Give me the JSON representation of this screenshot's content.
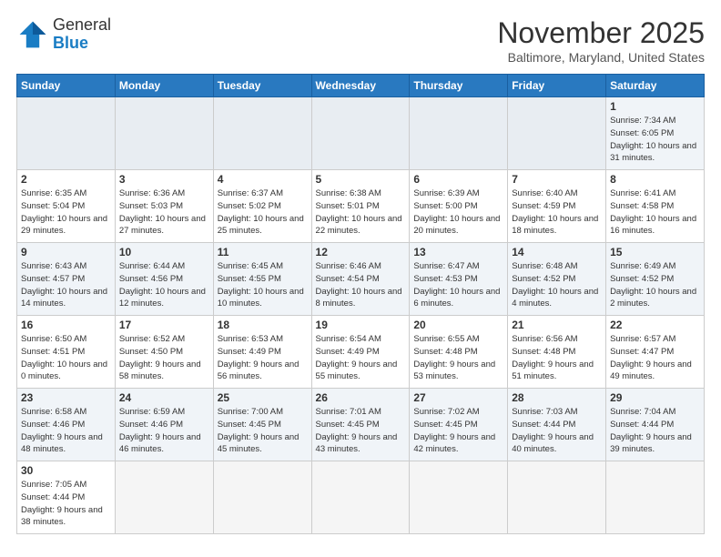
{
  "header": {
    "logo_general": "General",
    "logo_blue": "Blue",
    "month_title": "November 2025",
    "location": "Baltimore, Maryland, United States"
  },
  "days_of_week": [
    "Sunday",
    "Monday",
    "Tuesday",
    "Wednesday",
    "Thursday",
    "Friday",
    "Saturday"
  ],
  "weeks": [
    [
      {
        "day": "",
        "info": ""
      },
      {
        "day": "",
        "info": ""
      },
      {
        "day": "",
        "info": ""
      },
      {
        "day": "",
        "info": ""
      },
      {
        "day": "",
        "info": ""
      },
      {
        "day": "",
        "info": ""
      },
      {
        "day": "1",
        "info": "Sunrise: 7:34 AM\nSunset: 6:05 PM\nDaylight: 10 hours and 31 minutes."
      }
    ],
    [
      {
        "day": "2",
        "info": "Sunrise: 6:35 AM\nSunset: 5:04 PM\nDaylight: 10 hours and 29 minutes."
      },
      {
        "day": "3",
        "info": "Sunrise: 6:36 AM\nSunset: 5:03 PM\nDaylight: 10 hours and 27 minutes."
      },
      {
        "day": "4",
        "info": "Sunrise: 6:37 AM\nSunset: 5:02 PM\nDaylight: 10 hours and 25 minutes."
      },
      {
        "day": "5",
        "info": "Sunrise: 6:38 AM\nSunset: 5:01 PM\nDaylight: 10 hours and 22 minutes."
      },
      {
        "day": "6",
        "info": "Sunrise: 6:39 AM\nSunset: 5:00 PM\nDaylight: 10 hours and 20 minutes."
      },
      {
        "day": "7",
        "info": "Sunrise: 6:40 AM\nSunset: 4:59 PM\nDaylight: 10 hours and 18 minutes."
      },
      {
        "day": "8",
        "info": "Sunrise: 6:41 AM\nSunset: 4:58 PM\nDaylight: 10 hours and 16 minutes."
      }
    ],
    [
      {
        "day": "9",
        "info": "Sunrise: 6:43 AM\nSunset: 4:57 PM\nDaylight: 10 hours and 14 minutes."
      },
      {
        "day": "10",
        "info": "Sunrise: 6:44 AM\nSunset: 4:56 PM\nDaylight: 10 hours and 12 minutes."
      },
      {
        "day": "11",
        "info": "Sunrise: 6:45 AM\nSunset: 4:55 PM\nDaylight: 10 hours and 10 minutes."
      },
      {
        "day": "12",
        "info": "Sunrise: 6:46 AM\nSunset: 4:54 PM\nDaylight: 10 hours and 8 minutes."
      },
      {
        "day": "13",
        "info": "Sunrise: 6:47 AM\nSunset: 4:53 PM\nDaylight: 10 hours and 6 minutes."
      },
      {
        "day": "14",
        "info": "Sunrise: 6:48 AM\nSunset: 4:52 PM\nDaylight: 10 hours and 4 minutes."
      },
      {
        "day": "15",
        "info": "Sunrise: 6:49 AM\nSunset: 4:52 PM\nDaylight: 10 hours and 2 minutes."
      }
    ],
    [
      {
        "day": "16",
        "info": "Sunrise: 6:50 AM\nSunset: 4:51 PM\nDaylight: 10 hours and 0 minutes."
      },
      {
        "day": "17",
        "info": "Sunrise: 6:52 AM\nSunset: 4:50 PM\nDaylight: 9 hours and 58 minutes."
      },
      {
        "day": "18",
        "info": "Sunrise: 6:53 AM\nSunset: 4:49 PM\nDaylight: 9 hours and 56 minutes."
      },
      {
        "day": "19",
        "info": "Sunrise: 6:54 AM\nSunset: 4:49 PM\nDaylight: 9 hours and 55 minutes."
      },
      {
        "day": "20",
        "info": "Sunrise: 6:55 AM\nSunset: 4:48 PM\nDaylight: 9 hours and 53 minutes."
      },
      {
        "day": "21",
        "info": "Sunrise: 6:56 AM\nSunset: 4:48 PM\nDaylight: 9 hours and 51 minutes."
      },
      {
        "day": "22",
        "info": "Sunrise: 6:57 AM\nSunset: 4:47 PM\nDaylight: 9 hours and 49 minutes."
      }
    ],
    [
      {
        "day": "23",
        "info": "Sunrise: 6:58 AM\nSunset: 4:46 PM\nDaylight: 9 hours and 48 minutes."
      },
      {
        "day": "24",
        "info": "Sunrise: 6:59 AM\nSunset: 4:46 PM\nDaylight: 9 hours and 46 minutes."
      },
      {
        "day": "25",
        "info": "Sunrise: 7:00 AM\nSunset: 4:45 PM\nDaylight: 9 hours and 45 minutes."
      },
      {
        "day": "26",
        "info": "Sunrise: 7:01 AM\nSunset: 4:45 PM\nDaylight: 9 hours and 43 minutes."
      },
      {
        "day": "27",
        "info": "Sunrise: 7:02 AM\nSunset: 4:45 PM\nDaylight: 9 hours and 42 minutes."
      },
      {
        "day": "28",
        "info": "Sunrise: 7:03 AM\nSunset: 4:44 PM\nDaylight: 9 hours and 40 minutes."
      },
      {
        "day": "29",
        "info": "Sunrise: 7:04 AM\nSunset: 4:44 PM\nDaylight: 9 hours and 39 minutes."
      }
    ],
    [
      {
        "day": "30",
        "info": "Sunrise: 7:05 AM\nSunset: 4:44 PM\nDaylight: 9 hours and 38 minutes."
      },
      {
        "day": "",
        "info": ""
      },
      {
        "day": "",
        "info": ""
      },
      {
        "day": "",
        "info": ""
      },
      {
        "day": "",
        "info": ""
      },
      {
        "day": "",
        "info": ""
      },
      {
        "day": "",
        "info": ""
      }
    ]
  ]
}
